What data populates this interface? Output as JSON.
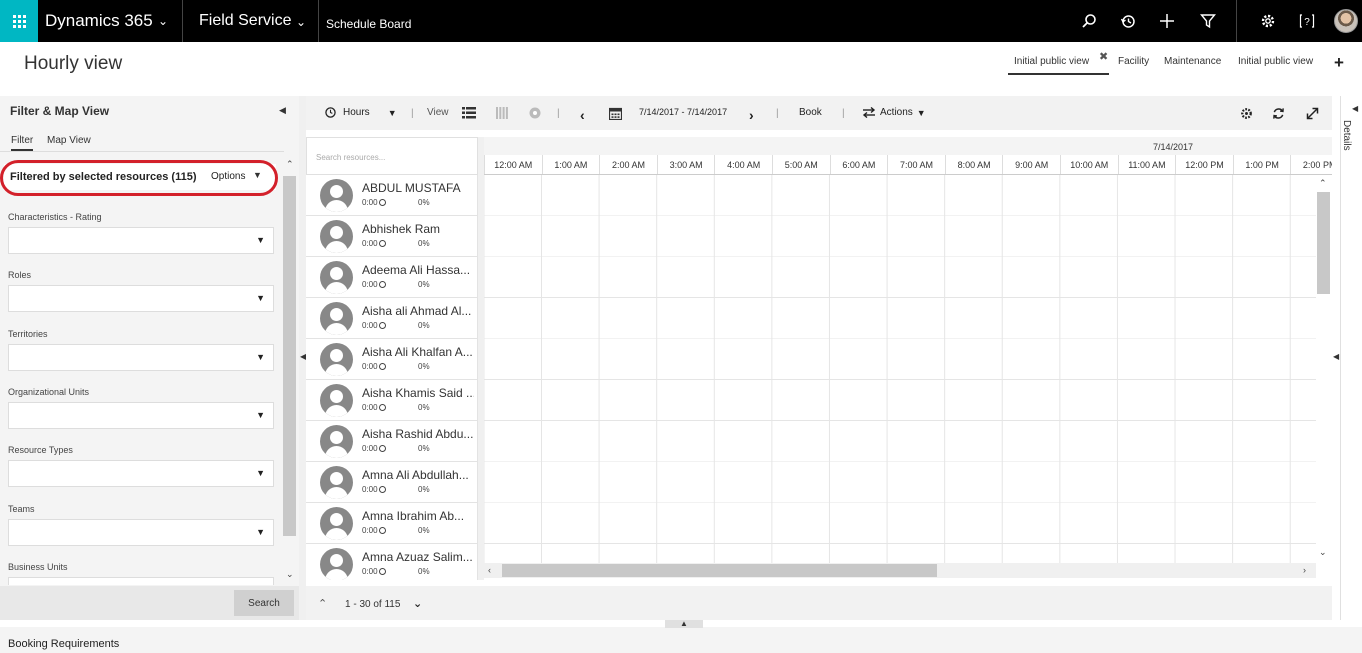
{
  "topbar": {
    "brand": "Dynamics 365",
    "app": "Field Service",
    "page": "Schedule Board",
    "icons": [
      "search-icon",
      "history-icon",
      "plus-icon",
      "filter-icon",
      "gear-icon",
      "help-icon",
      "user-avatar"
    ]
  },
  "header": {
    "title": "Hourly view",
    "view_tabs": [
      {
        "label": "Initial public view",
        "active": true
      },
      {
        "label": "Facility"
      },
      {
        "label": "Maintenance"
      },
      {
        "label": "Initial public view"
      }
    ],
    "close_glyph": "✖",
    "add_glyph": "+"
  },
  "left_panel": {
    "title": "Filter & Map View",
    "tabs": [
      "Filter",
      "Map View"
    ],
    "filtered_text": "Filtered by selected resources (115)",
    "options_label": "Options",
    "filters": [
      "Characteristics - Rating",
      "Roles",
      "Territories",
      "Organizational Units",
      "Resource Types",
      "Teams",
      "Business Units"
    ],
    "search_label": "Search",
    "highlight_color": "#d3202a"
  },
  "toolbar": {
    "hours_label": "Hours",
    "view_label": "View",
    "date_range": "7/14/2017 - 7/14/2017",
    "book_label": "Book",
    "actions_label": "Actions"
  },
  "board": {
    "search_placeholder": "Search resources...",
    "date": "7/14/2017",
    "hours": [
      "12:00 AM",
      "1:00 AM",
      "2:00 AM",
      "3:00 AM",
      "4:00 AM",
      "5:00 AM",
      "6:00 AM",
      "7:00 AM",
      "8:00 AM",
      "9:00 AM",
      "10:00 AM",
      "11:00 AM",
      "12:00 PM",
      "1:00 PM",
      "2:00 PM"
    ],
    "resources": [
      {
        "name": "ABDUL MUSTAFA",
        "time": "0:00",
        "pct": "0%"
      },
      {
        "name": "Abhishek Ram",
        "time": "0:00",
        "pct": "0%"
      },
      {
        "name": "Adeema Ali Hassa...",
        "time": "0:00",
        "pct": "0%"
      },
      {
        "name": "Aisha ali Ahmad Al...",
        "time": "0:00",
        "pct": "0%"
      },
      {
        "name": "Aisha Ali Khalfan A...",
        "time": "0:00",
        "pct": "0%"
      },
      {
        "name": "Aisha Khamis Said ...",
        "time": "0:00",
        "pct": "0%"
      },
      {
        "name": "Aisha Rashid Abdu...",
        "time": "0:00",
        "pct": "0%"
      },
      {
        "name": "Amna Ali Abdullah...",
        "time": "0:00",
        "pct": "0%"
      },
      {
        "name": "Amna Ibrahim Ab...",
        "time": "0:00",
        "pct": "0%"
      },
      {
        "name": "Amna Azuaz Salim...",
        "time": "0:00",
        "pct": "0%"
      }
    ],
    "pager_text": "1 - 30 of 115"
  },
  "details_label": "Details",
  "bottom_title": "Booking Requirements",
  "colors": {
    "accent": "#00b7c3",
    "topbar": "#000000"
  }
}
